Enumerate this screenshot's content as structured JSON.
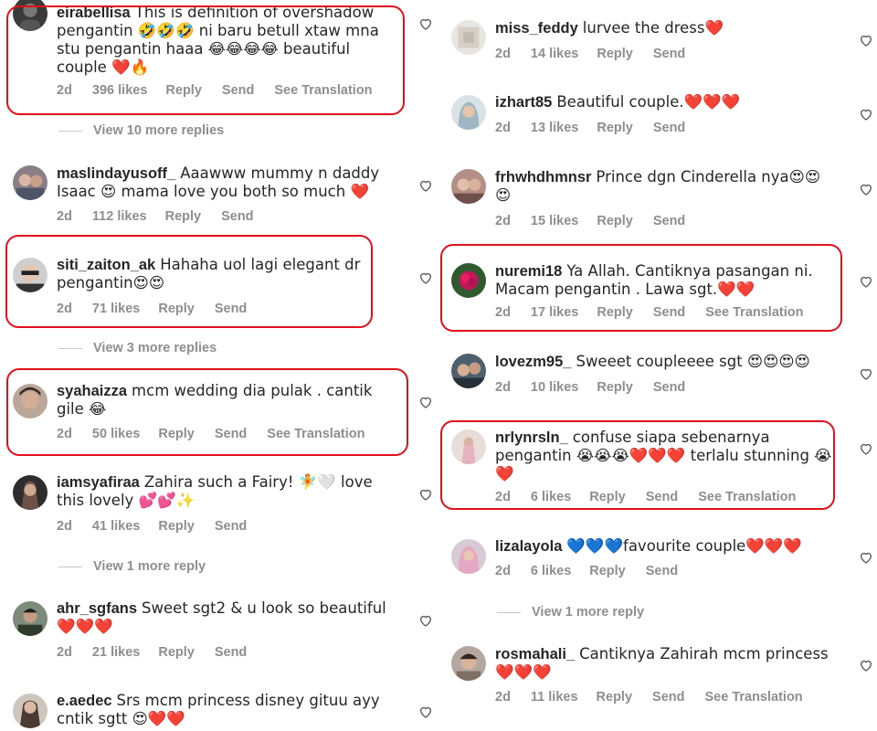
{
  "comments_left": [
    {
      "user": "eirabellisa",
      "text": "This is definition of overshadow pengantin 🤣🤣🤣 ni baru betull xtaw mna stu pengantin haaa 😂😂😂😂 beautiful couple ❤️🔥",
      "time": "2d",
      "likes": "396 likes",
      "reply": "Reply",
      "send": "Send",
      "translate": "See Translation"
    },
    {
      "user": "maslindayusoff_",
      "text": "Aaawww mummy n daddy Isaac 😍 mama love you both so much ❤️",
      "time": "2d",
      "likes": "112 likes",
      "reply": "Reply",
      "send": "Send"
    },
    {
      "user": "siti_zaiton_ak",
      "text": "Hahaha uol lagi elegant dr pengantin😍😍",
      "time": "2d",
      "likes": "71 likes",
      "reply": "Reply",
      "send": "Send"
    },
    {
      "user": "syahaizza",
      "text": "mcm wedding dia pulak . cantik gile 😂",
      "time": "2d",
      "likes": "50 likes",
      "reply": "Reply",
      "send": "Send",
      "translate": "See Translation"
    },
    {
      "user": "iamsyafiraa",
      "text": "Zahira such a Fairy! 🧚🤍 love this lovely 💕💕✨",
      "time": "2d",
      "likes": "41 likes",
      "reply": "Reply",
      "send": "Send"
    },
    {
      "user": "ahr_sgfans",
      "text": "Sweet sgt2 & u look so beautiful ❤️❤️❤️",
      "time": "2d",
      "likes": "21 likes",
      "reply": "Reply",
      "send": "Send"
    },
    {
      "user": "e.aedec",
      "text": "Srs mcm princess disney gituu ayy cntik sgtt 😍❤️❤️",
      "time": "",
      "likes": "",
      "reply": "",
      "send": ""
    }
  ],
  "more_left": [
    "View 10 more replies",
    "View 3 more replies",
    "View 1 more reply"
  ],
  "comments_right": [
    {
      "user": "miss_feddy",
      "text": "lurvee the dress❤️",
      "time": "2d",
      "likes": "14 likes",
      "reply": "Reply",
      "send": "Send"
    },
    {
      "user": "izhart85",
      "text": "Beautiful couple.❤️❤️❤️",
      "time": "2d",
      "likes": "13 likes",
      "reply": "Reply",
      "send": "Send"
    },
    {
      "user": "frhwhdhmnsr",
      "text": "Prince dgn Cinderella nya😍😍😍",
      "time": "2d",
      "likes": "15 likes",
      "reply": "Reply",
      "send": "Send"
    },
    {
      "user": "nuremi18",
      "text": "Ya Allah. Cantiknya pasangan ni. Macam pengantin . Lawa sgt.❤️❤️",
      "time": "2d",
      "likes": "17 likes",
      "reply": "Reply",
      "send": "Send",
      "translate": "See Translation"
    },
    {
      "user": "lovezm95_",
      "text": "Sweeet coupleeee sgt 😍😍😍😍",
      "time": "2d",
      "likes": "10 likes",
      "reply": "Reply",
      "send": "Send"
    },
    {
      "user": "nrlynrsln_",
      "text": "confuse siapa sebenarnya pengantin 😭😭😭❤️❤️❤️ terlalu stunning 😭❤️",
      "time": "2d",
      "likes": "6 likes",
      "reply": "Reply",
      "send": "Send",
      "translate": "See Translation"
    },
    {
      "user": "lizalayola",
      "text": "💙💙💙favourite couple❤️❤️❤️",
      "time": "2d",
      "likes": "6 likes",
      "reply": "Reply",
      "send": "Send"
    },
    {
      "user": "rosmahali_",
      "text": "Cantiknya Zahirah mcm princess ❤️❤️❤️",
      "time": "2d",
      "likes": "11 likes",
      "reply": "Reply",
      "send": "Send",
      "translate": "See Translation"
    }
  ],
  "more_right": [
    "View 1 more reply"
  ],
  "colors": {
    "highlight": "#e0101c",
    "meta": "#8e8e8e",
    "text": "#262626"
  }
}
